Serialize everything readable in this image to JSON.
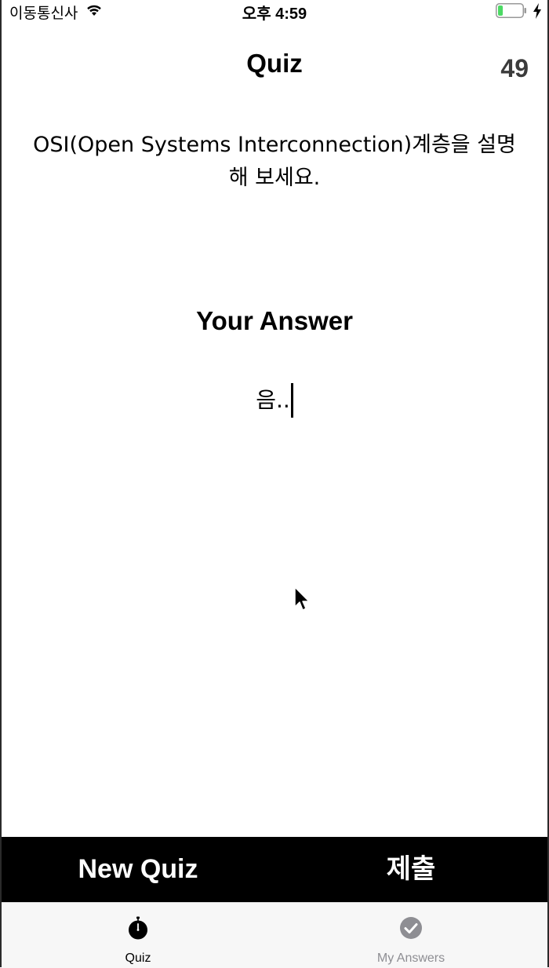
{
  "status_bar": {
    "carrier": "이동통신사",
    "time": "오후 4:59",
    "battery_level": 0.2
  },
  "header": {
    "title": "Quiz",
    "timer": "49"
  },
  "question": {
    "text": "OSI(Open Systems Interconnection)계층을 설명해 보세요."
  },
  "answer": {
    "heading": "Your Answer",
    "value": "음.."
  },
  "actions": {
    "new_quiz_label": "New Quiz",
    "submit_label": "제출"
  },
  "tabs": [
    {
      "label": "Quiz",
      "icon": "stopwatch-icon",
      "selected": true
    },
    {
      "label": "My Answers",
      "icon": "checkmark-circle-icon",
      "selected": false
    }
  ],
  "colors": {
    "action_bar_bg": "#000000",
    "tab_bar_bg": "#f7f7f7",
    "tab_inactive": "#8e8e93",
    "battery_fill": "#4cd964"
  }
}
